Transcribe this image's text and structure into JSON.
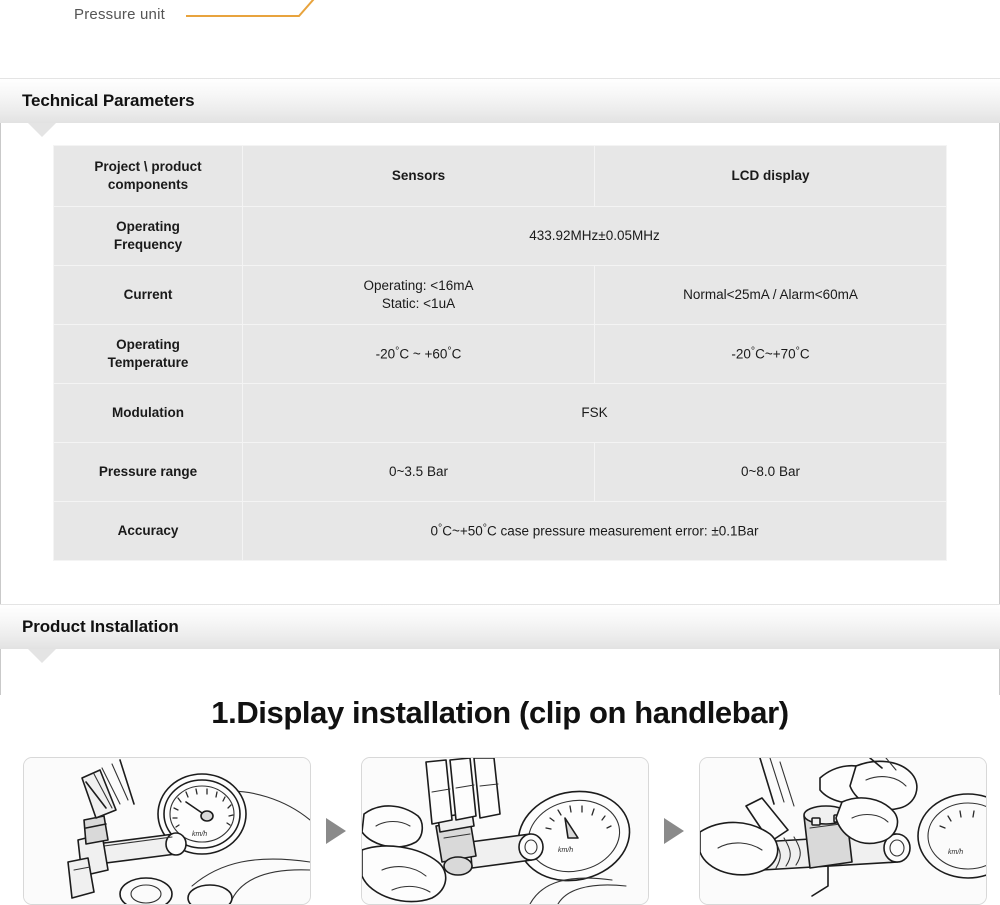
{
  "callout": {
    "label": "Pressure unit",
    "line_color": "#e8a33d"
  },
  "sections": [
    {
      "id": "technical-parameters",
      "title": "Technical Parameters"
    },
    {
      "id": "product-installation",
      "title": "Product Installation"
    }
  ],
  "spec_table": {
    "columns": [
      "Project \\ product components",
      "Sensors",
      "LCD display"
    ],
    "rows": [
      {
        "label": "Operating Frequency",
        "span": true,
        "value": "433.92MHz±0.05MHz"
      },
      {
        "label": "Current",
        "span": false,
        "sensor": "Operating: <16mA\nStatic: <1uA",
        "sensor_line1": "Operating: <16mA",
        "sensor_line2": "Static: <1uA",
        "lcd": "Normal<25mA / Alarm<60mA"
      },
      {
        "label": "Operating Temperature",
        "span": false,
        "sensor": "-20°C ~ +60°C",
        "lcd": "-20°C~+70°C"
      },
      {
        "label": "Modulation",
        "span": true,
        "value": "FSK"
      },
      {
        "label": "Pressure range",
        "span": false,
        "sensor": "0~3.5 Bar",
        "lcd": "0~8.0 Bar"
      },
      {
        "label": "Accuracy",
        "span": true,
        "value": "0°C~+50°C case pressure measurement error: ±0.1Bar"
      }
    ]
  },
  "installation": {
    "heading": "1.Display installation (clip on handlebar)",
    "steps": [
      {
        "n": 1,
        "alt": "motorcycle handlebar with speedometer"
      },
      {
        "n": 2,
        "alt": "hand placing display clip on handlebar"
      },
      {
        "n": 3,
        "alt": "hands tightening display clip onto handlebar"
      }
    ],
    "arrow_color": "#8a8a8a"
  },
  "labels": {
    "col_components": "Project \\ product components",
    "col_components_l1": "Project \\ product",
    "col_components_l2": "components",
    "col_sensors": "Sensors",
    "col_lcd": "LCD display",
    "row_freq_l1": "Operating",
    "row_freq_l2": "Frequency",
    "row_current": "Current",
    "row_temp_l1": "Operating",
    "row_temp_l2": "Temperature",
    "row_mod": "Modulation",
    "row_pressure": "Pressure range",
    "row_accuracy": "Accuracy",
    "freq_value": "433.92MHz±0.05MHz",
    "cur_sensor_1": "Operating: <16mA",
    "cur_sensor_2": "Static: <1uA",
    "cur_lcd": "Normal<25mA / Alarm<60mA",
    "temp_sensor_pre": "-20",
    "temp_sensor_mid": "C ~ +60",
    "temp_sensor_end": "C",
    "temp_lcd_pre": "-20",
    "temp_lcd_mid": "C~+70",
    "temp_lcd_end": "C",
    "mod_value": "FSK",
    "pres_sensor": "0~3.5 Bar",
    "pres_lcd": "0~8.0 Bar",
    "acc_pre": "0",
    "acc_mid": "C~+50",
    "acc_post": "C case pressure measurement error: ±0.1Bar",
    "degree": "°"
  }
}
